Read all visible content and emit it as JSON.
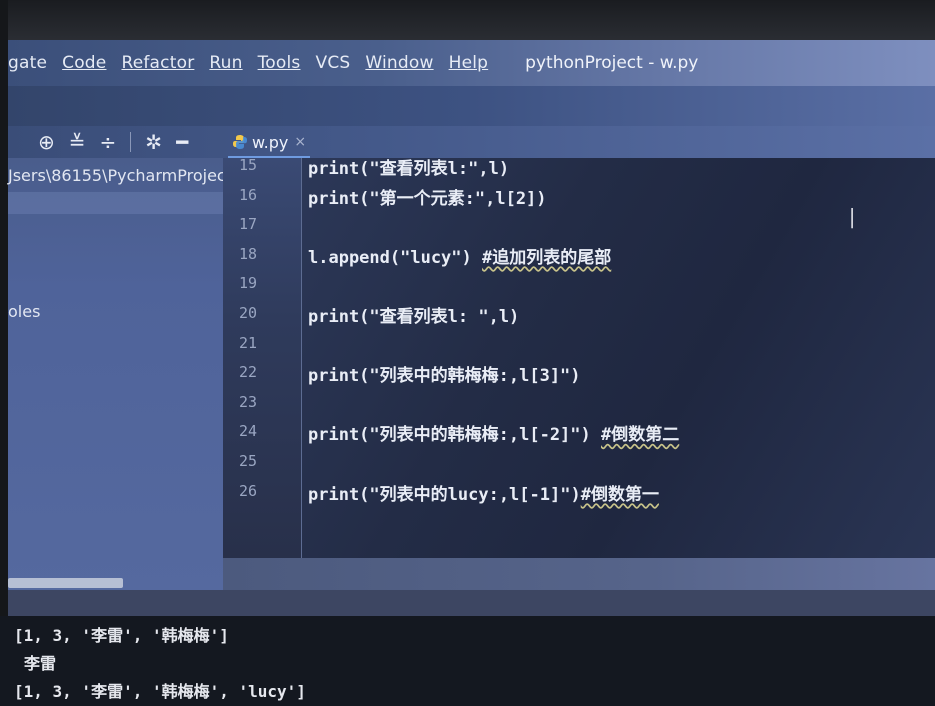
{
  "menu": {
    "items": [
      "gate",
      "Code",
      "Refactor",
      "Run",
      "Tools",
      "VCS",
      "Window",
      "Help"
    ],
    "window_title": "pythonProject - w.py"
  },
  "toolbar": {
    "icons": [
      "target-icon",
      "collapse-icon",
      "expand-icon",
      "gear-icon",
      "minimize-icon"
    ]
  },
  "tab": {
    "label": "w.py",
    "close": "×"
  },
  "project": {
    "path": "Jsers\\86155\\PycharmProjec",
    "node": "oles"
  },
  "editor": {
    "lines": [
      {
        "n": "15",
        "code": "print(\"查看列表l:\",l)",
        "comment": ""
      },
      {
        "n": "16",
        "code": "print(\"第一个元素:\",l[2])",
        "comment": ""
      },
      {
        "n": "17",
        "code": "",
        "comment": ""
      },
      {
        "n": "18",
        "code": "l.append(\"lucy\") ",
        "comment": "#追加列表的尾部"
      },
      {
        "n": "19",
        "code": "",
        "comment": ""
      },
      {
        "n": "20",
        "code": "print(\"查看列表l: \",l)",
        "comment": ""
      },
      {
        "n": "21",
        "code": "",
        "comment": ""
      },
      {
        "n": "22",
        "code": "print(\"列表中的韩梅梅:,l[3]\")",
        "comment": ""
      },
      {
        "n": "23",
        "code": "",
        "comment": ""
      },
      {
        "n": "24",
        "code": "print(\"列表中的韩梅梅:,l[-2]\") ",
        "comment": "#倒数第二"
      },
      {
        "n": "25",
        "code": "",
        "comment": ""
      },
      {
        "n": "26",
        "code": "print(\"列表中的lucy:,l[-1]\")",
        "comment": "#倒数第一"
      }
    ]
  },
  "console": {
    "lines": [
      "[1, 3, '李雷', '韩梅梅']",
      "李雷",
      "[1, 3, '李雷', '韩梅梅', 'lucy']"
    ]
  }
}
